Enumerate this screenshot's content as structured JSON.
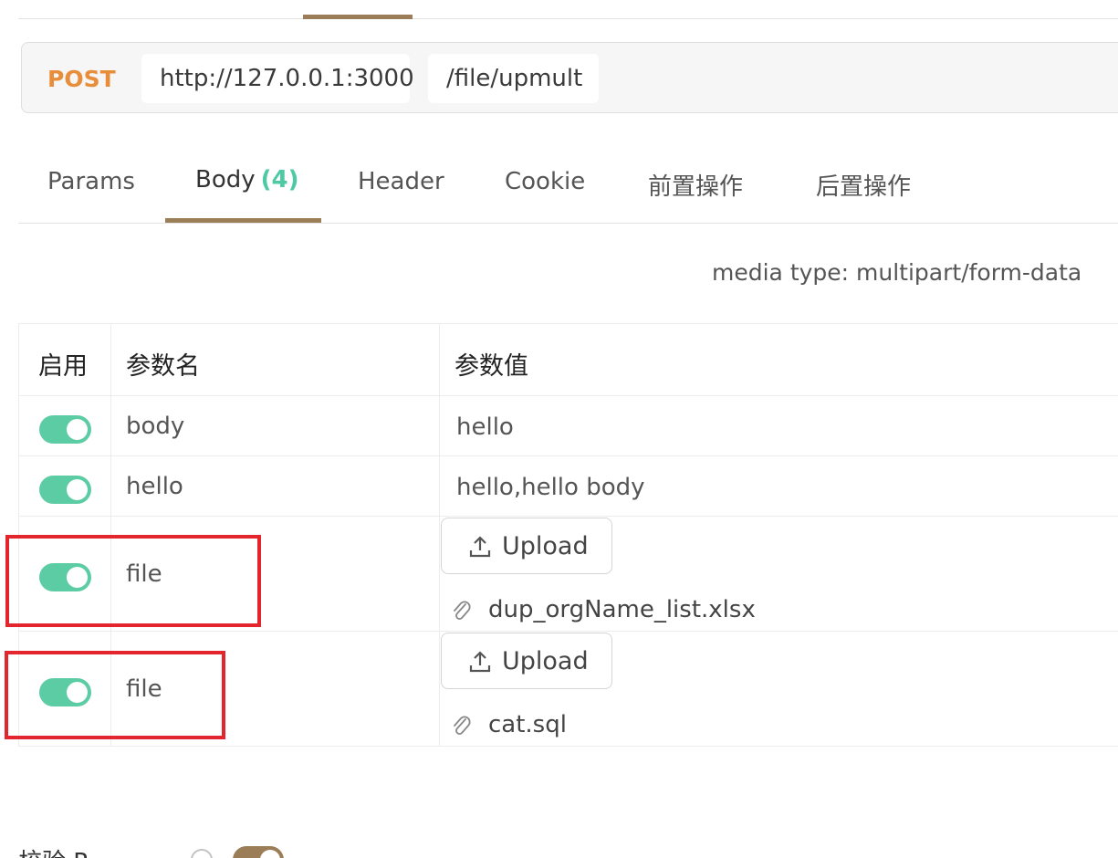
{
  "request": {
    "method": "POST",
    "host": "http://127.0.0.1:3000",
    "path": "/file/upmult"
  },
  "tabs": [
    {
      "label": "Params"
    },
    {
      "label": "Body",
      "count": "(4)"
    },
    {
      "label": "Header"
    },
    {
      "label": "Cookie"
    },
    {
      "label": "前置操作"
    },
    {
      "label": "后置操作"
    }
  ],
  "body": {
    "media_type": "media type: multipart/form-data",
    "columns": {
      "enabled": "启用",
      "name": "参数名",
      "value": "参数值"
    },
    "rows": [
      {
        "enabled": true,
        "name": "body",
        "value": "hello"
      },
      {
        "enabled": true,
        "name": "hello",
        "value": "hello,hello body"
      },
      {
        "enabled": true,
        "name": "file",
        "upload_label": "Upload",
        "file": "dup_orgName_list.xlsx"
      },
      {
        "enabled": true,
        "name": "file",
        "upload_label": "Upload",
        "file": "cat.sql"
      }
    ]
  },
  "footer": {
    "label": "校验 R"
  },
  "colors": {
    "method": "#e88d3a",
    "accent": "#9b7e58",
    "toggle_on": "#5ccca5",
    "count": "#4dc9a3",
    "highlight": "#e3252e"
  },
  "icons": [
    "upload-icon",
    "paperclip-icon",
    "help-icon"
  ]
}
